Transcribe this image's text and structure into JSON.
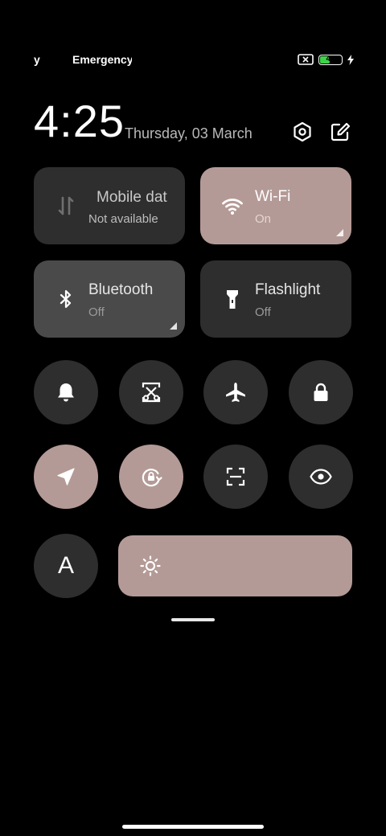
{
  "status_bar": {
    "carrier_1": "y",
    "carrier_2": "Emergency",
    "battery_level": "42",
    "battery_color": "#3fd34a"
  },
  "header": {
    "time": "4:25",
    "date": "Thursday, 03 March",
    "settings_icon": "settings-hex-icon",
    "edit_icon": "edit-icon"
  },
  "tiles": [
    {
      "title": "Mobile dat",
      "subtitle": "Not available",
      "icon": "mobile-data-icon",
      "state": "unavailable"
    },
    {
      "title": "Wi-Fi",
      "subtitle": "On",
      "icon": "wifi-icon",
      "state": "on"
    },
    {
      "title": "Bluetooth",
      "subtitle": "Off",
      "icon": "bluetooth-icon",
      "state": "off"
    },
    {
      "title": "Flashlight",
      "subtitle": "Off",
      "icon": "flashlight-icon",
      "state": "off"
    }
  ],
  "toggles_row1": [
    {
      "icon": "bell-icon",
      "state": "off"
    },
    {
      "icon": "screenshot-icon",
      "state": "off"
    },
    {
      "icon": "airplane-icon",
      "state": "off"
    },
    {
      "icon": "lock-icon",
      "state": "off"
    }
  ],
  "toggles_row2": [
    {
      "icon": "location-icon",
      "state": "on"
    },
    {
      "icon": "rotation-lock-icon",
      "state": "on"
    },
    {
      "icon": "scanner-icon",
      "state": "off"
    },
    {
      "icon": "eye-icon",
      "state": "off"
    }
  ],
  "row3": {
    "auto_brightness_label": "A",
    "brightness_icon": "sun-icon",
    "brightness_level": 1.0
  },
  "colors": {
    "accent": "#b49a96",
    "tile_off": "#2e2e2e",
    "background": "#000000"
  }
}
